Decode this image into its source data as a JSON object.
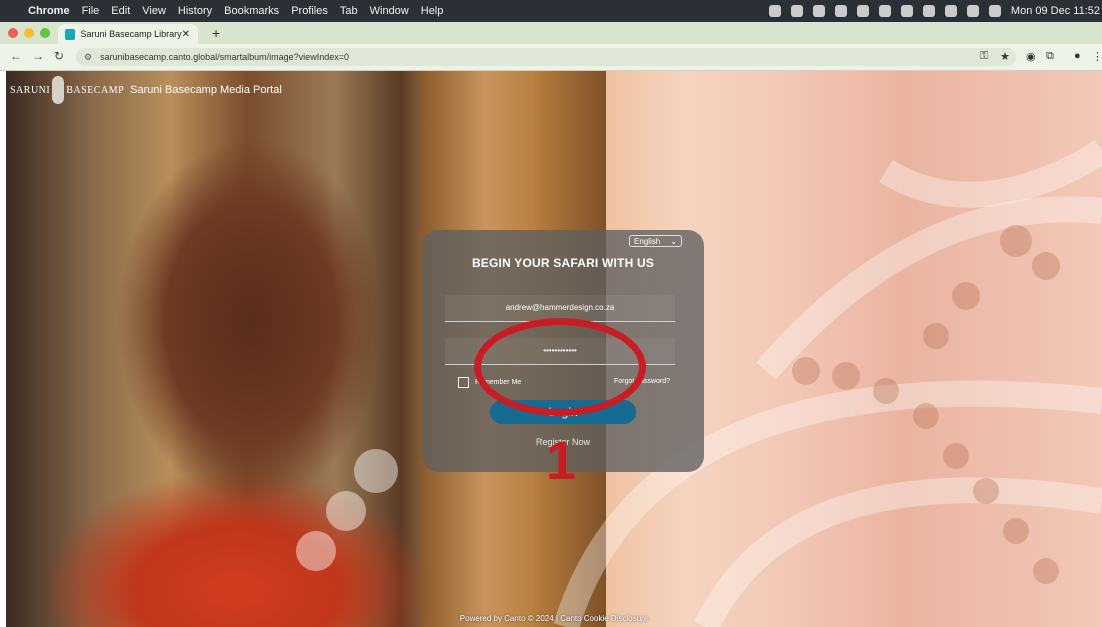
{
  "menubar": {
    "items": [
      "Chrome",
      "File",
      "Edit",
      "View",
      "History",
      "Bookmarks",
      "Profiles",
      "Tab",
      "Window",
      "Help"
    ],
    "clock": "Mon 09 Dec  11:52"
  },
  "browser": {
    "tab_title": "Saruni Basecamp Library",
    "url": "sarunibasecamp.canto.global/smartalbum/image?viewIndex=0"
  },
  "header": {
    "brand_left": "SARUNI",
    "brand_right": "BASECAMP",
    "portal_title": "Saruni Basecamp Media Portal"
  },
  "login": {
    "language": "English",
    "heading": "BEGIN YOUR SAFARI WITH US",
    "email_value": "andrew@hammerdesign.co.za",
    "password_value": "••••••••••••",
    "remember_label": "Remember Me",
    "forgot_label": "Forgot password?",
    "login_button": "Login",
    "register_link": "Register Now"
  },
  "annotation": {
    "number": "1",
    "color": "#c81d25"
  },
  "footer": {
    "text": "Powered by Canto © 2024 | Canto Cookie Disclosure"
  },
  "colors": {
    "login_button": "#176a92",
    "tab_strip": "#d9e4ce"
  }
}
